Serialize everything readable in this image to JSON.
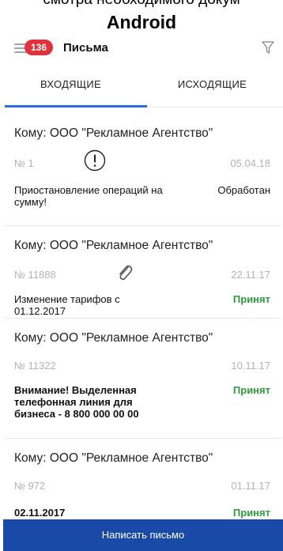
{
  "caption": {
    "top_text": "смотра необходимого докум",
    "platform": "Android"
  },
  "header": {
    "unread_count": "136",
    "title": "Письма"
  },
  "tabs": [
    {
      "label": "ВХОДЯЩИЕ",
      "active": true
    },
    {
      "label": "ИСХОДЯЩИЕ",
      "active": false
    }
  ],
  "letters": [
    {
      "to": "Кому: ООО \"Рекламное Агентство\"",
      "number": "№ 1",
      "date": "05.04.18",
      "subject": "Приостановление операций на сумму!",
      "status": "Обработан",
      "icon": "exclamation-icon"
    },
    {
      "to": "Кому: ООО \"Рекламное Агентство\"",
      "number": "№ 11888",
      "date": "22.11.17",
      "subject": "Изменение тарифов с 01.12.2017",
      "status": "Принят",
      "icon": "paperclip-icon"
    },
    {
      "to": "Кому: ООО \"Рекламное Агентство\"",
      "number": "№ 11322",
      "date": "10.11.17",
      "subject": "Внимание! Выделенная телефонная линия для бизнеса - 8 800 000 00 00",
      "status": "Принят",
      "icon": ""
    },
    {
      "to": "Кому: ООО \"Рекламное Агентство\"",
      "number": "№ 972",
      "date": "01.11.17",
      "subject": "02.11.2017",
      "status": "Принят",
      "icon": ""
    }
  ],
  "compose_button": "Написать письмо",
  "colors": {
    "accent": "#2d6ae3",
    "badge": "#e0323c",
    "accepted": "#2e9a3e",
    "button": "#1a4aa8"
  }
}
